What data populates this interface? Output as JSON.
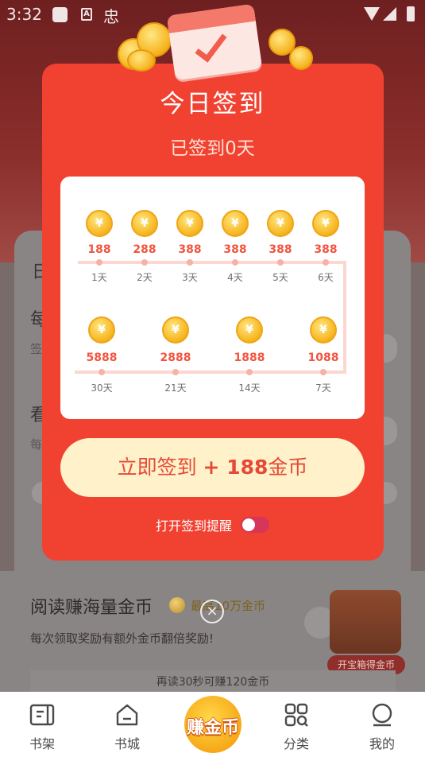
{
  "status_bar": {
    "time": "3:32",
    "app_badge": "A",
    "app_text": "忠"
  },
  "background": {
    "frag_day": "日",
    "frag_every": "每",
    "frag_sign": "签",
    "frag_watch": "看",
    "frag_each": "每",
    "section_title": "阅读赚海量金币",
    "earn_amount": "最高10万金币",
    "section_sub": "每次领取奖励有额外金币翻倍奖励!",
    "read_progress": "再读30秒可赚120金币",
    "chest_button": "开宝箱得金币"
  },
  "modal": {
    "title": "今日签到",
    "subtitle": "已签到0天",
    "coin_symbol": "¥",
    "row1": [
      {
        "amount": "188",
        "day": "1天"
      },
      {
        "amount": "288",
        "day": "2天"
      },
      {
        "amount": "388",
        "day": "3天"
      },
      {
        "amount": "388",
        "day": "4天"
      },
      {
        "amount": "388",
        "day": "5天"
      },
      {
        "amount": "388",
        "day": "6天"
      }
    ],
    "row2": [
      {
        "amount": "5888",
        "day": "30天"
      },
      {
        "amount": "2888",
        "day": "21天"
      },
      {
        "amount": "1888",
        "day": "14天"
      },
      {
        "amount": "1088",
        "day": "7天"
      }
    ],
    "cta_prefix": "立即签到",
    "cta_bonus": "+ 188",
    "cta_suffix": "金币",
    "remind_label": "打开签到提醒",
    "remind_on": false,
    "close_symbol": "×"
  },
  "bottom_nav": {
    "bookshelf": "书架",
    "bookstore": "书城",
    "earn": "赚金币",
    "category": "分类",
    "mine": "我的"
  },
  "colors": {
    "modal_red": "#f04131",
    "coin_gold": "#f7b824",
    "amount_red": "#f2553f",
    "cta_bg": "#fff1c9",
    "toggle_off": "#d7355a"
  }
}
